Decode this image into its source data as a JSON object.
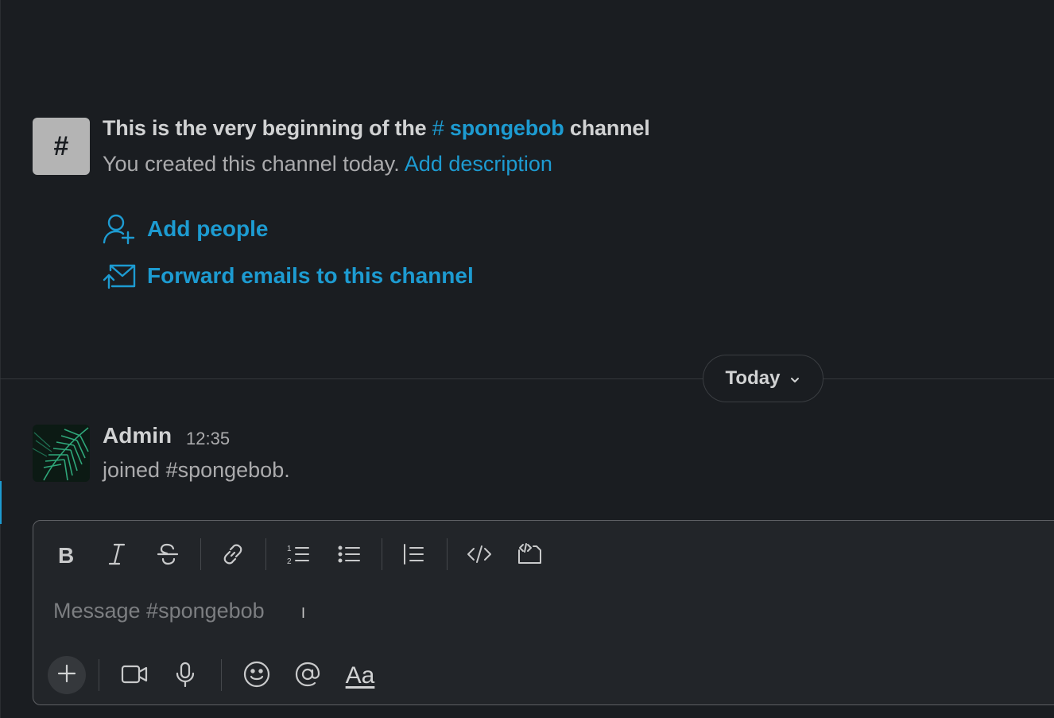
{
  "channel": {
    "name": "spongebob",
    "intro_prefix": "This is the very beginning of the",
    "hash_symbol": "#",
    "intro_suffix": "channel",
    "created_text": "You created this channel today.",
    "add_description_label": "Add description",
    "icon_glyph": "#"
  },
  "actions": {
    "add_people_label": "Add people",
    "forward_emails_label": "Forward emails to this channel"
  },
  "divider": {
    "label": "Today"
  },
  "message": {
    "author": "Admin",
    "time": "12:35",
    "text": "joined #spongebob."
  },
  "composer": {
    "placeholder": "Message #spongebob",
    "format_text_label": "Aa"
  },
  "colors": {
    "background": "#1a1d21",
    "accent": "#1d9bd1",
    "text": "#d1d2d3",
    "muted": "#ababad"
  },
  "icons": [
    "hash-icon",
    "add-person-icon",
    "forward-email-icon",
    "chevron-down-icon",
    "bold-icon",
    "italic-icon",
    "strikethrough-icon",
    "link-icon",
    "ordered-list-icon",
    "bulleted-list-icon",
    "blockquote-icon",
    "code-icon",
    "code-block-icon",
    "plus-icon",
    "video-icon",
    "microphone-icon",
    "emoji-icon",
    "mention-icon"
  ]
}
